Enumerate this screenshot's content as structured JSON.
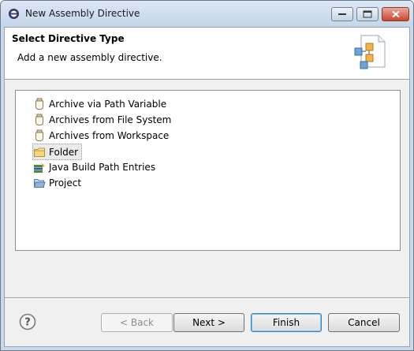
{
  "window": {
    "title": "New Assembly Directive"
  },
  "banner": {
    "heading": "Select Directive Type",
    "description": "Add a new assembly directive."
  },
  "tree": {
    "items": [
      {
        "label": "Archive via Path Variable",
        "icon": "jar-icon",
        "selected": false
      },
      {
        "label": "Archives from File System",
        "icon": "jar-icon",
        "selected": false
      },
      {
        "label": "Archives from Workspace",
        "icon": "jar-icon",
        "selected": false
      },
      {
        "label": "Folder",
        "icon": "folder-icon",
        "selected": true
      },
      {
        "label": "Java Build Path Entries",
        "icon": "library-icon",
        "selected": false
      },
      {
        "label": "Project",
        "icon": "open-folder-icon",
        "selected": false
      }
    ]
  },
  "buttons": {
    "back": "< Back",
    "next": "Next >",
    "finish": "Finish",
    "cancel": "Cancel"
  },
  "colors": {
    "titlebar": "#c5d6ea",
    "dialog_bg": "#f0f0f0",
    "default_button_border": "#3c7fb1"
  }
}
